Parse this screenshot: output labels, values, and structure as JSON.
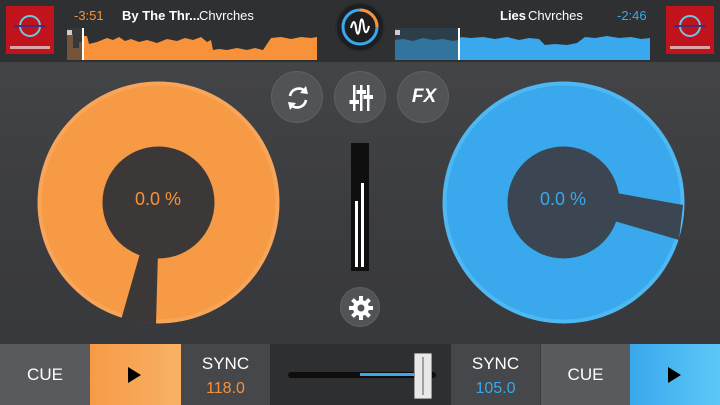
{
  "deck_left": {
    "time_remaining": "-3:51",
    "title": "By The Thr...",
    "artist": "Chvrches",
    "pitch_percent": "0.0 %",
    "cue_label": "CUE",
    "sync_label": "SYNC",
    "bpm": "118.0",
    "accent_color": "#f7923a",
    "play_icon": "play-icon"
  },
  "deck_right": {
    "time_remaining": "-2:46",
    "title": "Lies",
    "artist": "Chvrches",
    "pitch_percent": "0.0 %",
    "cue_label": "CUE",
    "sync_label": "SYNC",
    "bpm": "105.0",
    "accent_color": "#39a8ec",
    "play_icon": "play-icon"
  },
  "center": {
    "loop_icon": "loop-icon",
    "mixer_icon": "mixer-sliders-icon",
    "fx_label": "FX",
    "settings_icon": "gear-icon",
    "logo_icon": "waveform-logo-icon"
  },
  "crossfader": {
    "position": 0.92
  },
  "colors": {
    "background": "#3b3c3f",
    "topbar": "#2f3032",
    "left_accent": "#f7923a",
    "right_accent": "#39a8ec"
  }
}
